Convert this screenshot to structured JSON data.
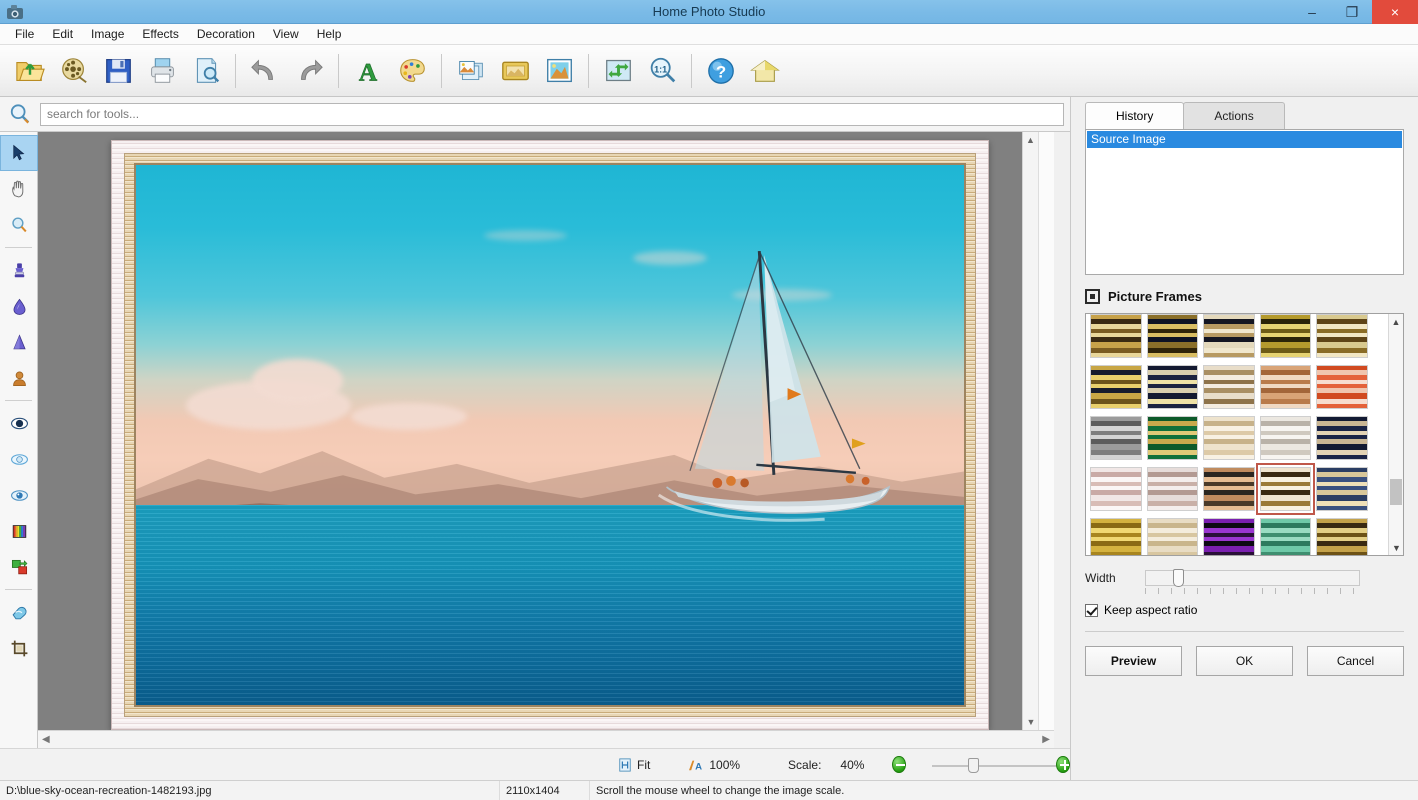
{
  "window": {
    "title": "Home Photo Studio",
    "app_icon": "camera-icon",
    "minimize": "–",
    "maximize": "❐",
    "close": "×"
  },
  "menu": {
    "items": [
      {
        "label": "File"
      },
      {
        "label": "Edit"
      },
      {
        "label": "Image"
      },
      {
        "label": "Effects"
      },
      {
        "label": "Decoration"
      },
      {
        "label": "View"
      },
      {
        "label": "Help"
      }
    ]
  },
  "toolbar": {
    "buttons": [
      {
        "name": "open-file-button",
        "icon": "open-folder-icon",
        "title": "Open"
      },
      {
        "name": "open-project-button",
        "icon": "film-reel-icon",
        "title": "Open project"
      },
      {
        "name": "save-button",
        "icon": "floppy-disk-icon",
        "title": "Save"
      },
      {
        "name": "print-button",
        "icon": "printer-icon",
        "title": "Print"
      },
      {
        "name": "print-preview-button",
        "icon": "page-magnifier-icon",
        "title": "Print preview"
      },
      {
        "name": "undo-button",
        "icon": "undo-arrow-icon",
        "title": "Undo"
      },
      {
        "name": "redo-button",
        "icon": "redo-arrow-icon",
        "title": "Redo"
      },
      {
        "name": "text-tool-button",
        "icon": "letter-a-icon",
        "title": "Add text"
      },
      {
        "name": "palette-button",
        "icon": "paint-palette-icon",
        "title": "Palette"
      },
      {
        "name": "collage-button",
        "icon": "stacked-photos-icon",
        "title": "Collage"
      },
      {
        "name": "frame-button",
        "icon": "gold-frame-icon",
        "title": "Frame"
      },
      {
        "name": "photo-effects-button",
        "icon": "framed-photo-icon",
        "title": "Photo"
      },
      {
        "name": "fit-screen-button",
        "icon": "fit-arrows-icon",
        "title": "Fit to screen"
      },
      {
        "name": "actual-size-button",
        "icon": "one-to-one-magnifier-icon",
        "title": "1:1"
      },
      {
        "name": "help-button",
        "icon": "question-mark-icon",
        "title": "Help"
      },
      {
        "name": "home-button",
        "icon": "house-icon",
        "title": "Home"
      }
    ]
  },
  "search": {
    "icon": "search-magnifier-icon",
    "placeholder": "search for tools...",
    "value": ""
  },
  "tools": {
    "items": [
      {
        "name": "selection-tool",
        "icon": "cursor-arrow-icon",
        "active": true
      },
      {
        "name": "hand-tool",
        "icon": "hand-icon",
        "active": false
      },
      {
        "name": "zoom-tool",
        "icon": "magnifier-icon",
        "active": false
      },
      {
        "name": "clone-stamp-tool",
        "icon": "stamp-icon",
        "active": false
      },
      {
        "name": "blur-drop-tool",
        "icon": "water-drop-icon",
        "active": false
      },
      {
        "name": "sharpen-tool",
        "icon": "cone-icon",
        "active": false
      },
      {
        "name": "portrait-retouch-tool",
        "icon": "person-bust-icon",
        "active": false
      },
      {
        "name": "brightness-tool",
        "icon": "contrast-circle-icon",
        "active": false
      },
      {
        "name": "red-eye-tool",
        "icon": "eye-outline-icon",
        "active": false
      },
      {
        "name": "eye-tool",
        "icon": "eye-icon",
        "active": false
      },
      {
        "name": "color-bars-tool",
        "icon": "color-spectrum-icon",
        "active": false
      },
      {
        "name": "replace-color-tool",
        "icon": "color-swap-icon",
        "active": false
      },
      {
        "name": "eraser-tool",
        "icon": "eraser-icon",
        "active": false
      },
      {
        "name": "crop-tool",
        "icon": "crop-icon",
        "active": false
      }
    ]
  },
  "panel": {
    "tabs": [
      {
        "label": "History",
        "active": true
      },
      {
        "label": "Actions",
        "active": false
      }
    ],
    "history": {
      "items": [
        {
          "label": "Source Image",
          "selected": true
        }
      ]
    },
    "frames_section": {
      "icon": "frame-square-icon",
      "title": "Picture Frames",
      "selected_index": 18,
      "swatches": [
        {
          "c1": "#c7a24a",
          "c2": "#3a2a12",
          "c3": "#e9d79a",
          "c4": "#7a5c22"
        },
        {
          "c1": "#8a6f2a",
          "c2": "#0d1224",
          "c3": "#d8bd63",
          "c4": "#2f2409"
        },
        {
          "c1": "#e4d9bc",
          "c2": "#141622",
          "c3": "#b79a62",
          "c4": "#f0e7cd"
        },
        {
          "c1": "#b49a2d",
          "c2": "#2a2408",
          "c3": "#e6d472",
          "c4": "#6d5c16"
        },
        {
          "c1": "#d8c98f",
          "c2": "#5e4417",
          "c3": "#f2e7c4",
          "c4": "#8a6c26"
        },
        {
          "c1": "#c8a645",
          "c2": "#161b2c",
          "c3": "#e8cf6b",
          "c4": "#6b531a"
        },
        {
          "c1": "#141a31",
          "c2": "#d9cfae",
          "c3": "#1b2340",
          "c4": "#efe2a6"
        },
        {
          "c1": "#e8ddc9",
          "c2": "#a98f63",
          "c3": "#f4ece0",
          "c4": "#8e734a"
        },
        {
          "c1": "#d9a477",
          "c2": "#a3663a",
          "c3": "#f0d9c3",
          "c4": "#b97b4b"
        },
        {
          "c1": "#d14a20",
          "c2": "#f0c5ae",
          "c3": "#e4623a",
          "c4": "#f7ddcf"
        },
        {
          "c1": "#9b9b9b",
          "c2": "#5c5c5c",
          "c3": "#d4d4d4",
          "c4": "#7e7e7e"
        },
        {
          "c1": "#0d5a2a",
          "c2": "#c9a94c",
          "c3": "#11703a",
          "c4": "#e0c977"
        },
        {
          "c1": "#eee3cd",
          "c2": "#c7b28a",
          "c3": "#f8f1e3",
          "c4": "#ddcaa7"
        },
        {
          "c1": "#ece8e1",
          "c2": "#b9b2a8",
          "c3": "#f7f5f1",
          "c4": "#cfc9bf"
        },
        {
          "c1": "#121a33",
          "c2": "#c9b694",
          "c3": "#1a2446",
          "c4": "#e3d3b4"
        },
        {
          "c1": "#f1e7e6",
          "c2": "#c9aaa6",
          "c3": "#fbf6f6",
          "c4": "#d8bcb6"
        },
        {
          "c1": "#e6dcd9",
          "c2": "#b39a92",
          "c3": "#f4eeec",
          "c4": "#c9b0a7"
        },
        {
          "c1": "#c08b5e",
          "c2": "#2b2620",
          "c3": "#e6bd92",
          "c4": "#4a3a28"
        },
        {
          "c1": "#efe4cf",
          "c2": "#3a2a12",
          "c3": "#f8f1e0",
          "c4": "#9a7a38"
        },
        {
          "c1": "#2a3d63",
          "c2": "#d8c79a",
          "c3": "#3a5180",
          "c4": "#efe0b8"
        },
        {
          "c1": "#d4b23f",
          "c2": "#8a6a14",
          "c3": "#f0d873",
          "c4": "#a8851f"
        },
        {
          "c1": "#e8dcc4",
          "c2": "#c9b58c",
          "c3": "#f4ecdc",
          "c4": "#d8c6a0"
        },
        {
          "c1": "#7a1fb0",
          "c2": "#0d0a14",
          "c3": "#9a36d0",
          "c4": "#2a1038"
        },
        {
          "c1": "#6fc9a8",
          "c2": "#2d7a5e",
          "c3": "#9adcc2",
          "c4": "#3f8f70"
        },
        {
          "c1": "#c4a24a",
          "c2": "#3a2a12",
          "c3": "#e4cf85",
          "c4": "#6d5216"
        }
      ]
    },
    "width": {
      "label": "Width",
      "value": 12
    },
    "keep_aspect": {
      "label": "Keep aspect ratio",
      "checked": true
    },
    "buttons": {
      "preview": "Preview",
      "ok": "OK",
      "cancel": "Cancel"
    }
  },
  "zoombar": {
    "fit_icon": "fit-page-icon",
    "fit_label": "Fit",
    "actual_icon": "actual-size-icon",
    "actual_label": "100%",
    "scale_label": "Scale:",
    "scale_value": "40%",
    "zoom_out_icon": "zoom-out-icon",
    "zoom_in_icon": "zoom-in-icon"
  },
  "statusbar": {
    "file_path": "D:\\blue-sky-ocean-recreation-1482193.jpg",
    "dimensions": "2110x1404",
    "hint": "Scroll the mouse wheel to change the image scale."
  },
  "colors": {
    "titlebar": "#7bbbe7",
    "close_button": "#e24b3c",
    "selection_blue": "#2a8ae0",
    "selected_frame_outline": "#c0584a",
    "canvas_bg": "#808080"
  }
}
